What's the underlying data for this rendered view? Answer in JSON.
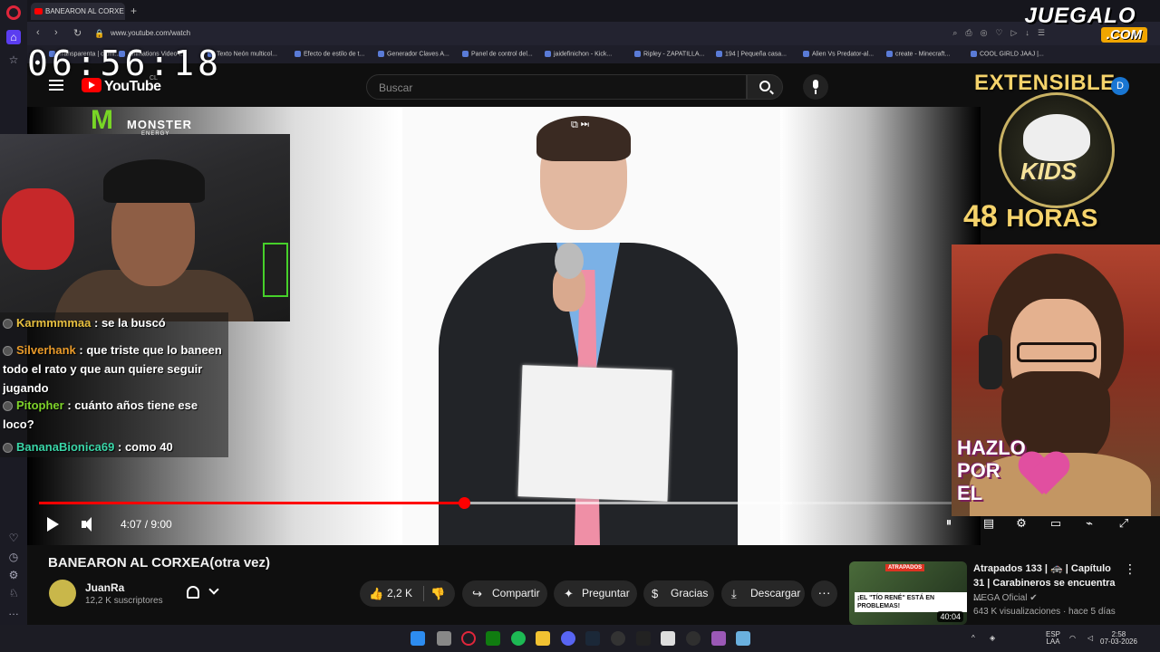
{
  "browser": {
    "tab_title": "BANEARON AL CORXE",
    "url": "www.youtube.com/watch",
    "bookmarks": [
      "Transparenta | carni...",
      "Animations Video f...",
      "Texto Neón multicol...",
      "Efecto de estilo de t...",
      "Generador Claves A...",
      "Panel de control del...",
      "jaidefinichon - Kick...",
      "Ripley - ZAPATILLA...",
      "194 | Pequeña casa...",
      "Alien Vs Predator-al...",
      "create - Minecraft...",
      "COOL GIRLD JAAJ |..."
    ]
  },
  "overlay": {
    "clock": "06:56:18",
    "site_logo_top": "JUEGALO",
    "site_logo_bottom": ".COM",
    "monster_title": "MONSTER",
    "monster_sub": "ENERGY",
    "promo_top": "EXTENSIBLE",
    "promo_kids": "KIDS",
    "promo_num": "48",
    "promo_hours": "HORAS",
    "promo_call": "HAZLO POR EL",
    "user_initial": "D"
  },
  "chat": [
    {
      "user": "Karmmmmaa",
      "msg": ": se la buscó",
      "user_color": "#e8c040"
    },
    {
      "user": "Silverhank",
      "msg": ": que triste que lo baneen todo el rato y que aun quiere seguir jugando",
      "user_color": "#e89a2a"
    },
    {
      "user": "Pitopher",
      "msg": ": cuánto años tiene ese loco?",
      "user_color": "#7ed32a"
    },
    {
      "user": "BananaBionica69",
      "msg": ": como 40",
      "user_color": "#3ad6a8"
    }
  ],
  "youtube": {
    "logo_text": "YouTube",
    "region": "CL",
    "search_placeholder": "Buscar",
    "time_display": "4:07 / 9:00",
    "progress_fraction": 0.457,
    "buffer_fraction": 0.81,
    "video_title": "BANEARON AL CORXEA(otra vez)",
    "channel": "JuanRa",
    "subscribers": "12,2 K suscriptores",
    "likes": "2,2 K",
    "share_label": "Compartir",
    "ask_label": "Preguntar",
    "thanks_label": "Gracias",
    "download_label": "Descargar"
  },
  "suggestion": {
    "title": "Atrapados 133 | 🚓 | Capítulo 31 | Carabineros se encuentra ...",
    "channel": "MEGA Oficial",
    "meta": "643 K visualizaciones · hace 5 días",
    "duration": "40:04",
    "thumb_tag": "ATRAPADOS",
    "thumb_label": "¡EL \"TÍO RENÉ\" ESTÁ EN PROBLEMAS!"
  },
  "taskbar": {
    "lang": "ESP",
    "lang2": "LAA",
    "time": "2:58",
    "date": "07-03-2026"
  },
  "colors": {
    "accent_red": "#ff0000",
    "background": "#0f0f0f"
  }
}
